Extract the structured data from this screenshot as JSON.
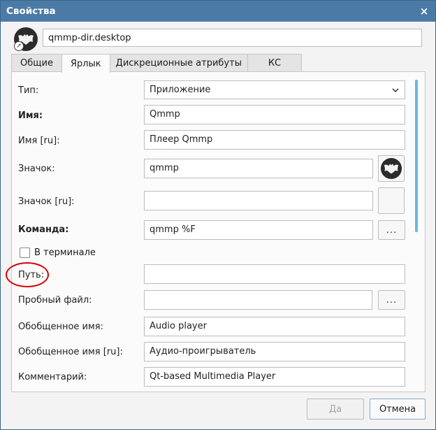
{
  "window": {
    "title": "Свойства",
    "close_glyph": "×",
    "icon_name": "qmmp-app-icon",
    "filename": "qmmp-dir.desktop"
  },
  "tabs": [
    {
      "label": "Общие",
      "active": false
    },
    {
      "label": "Ярлык",
      "active": true
    },
    {
      "label": "Дискреционные атрибуты",
      "active": false
    },
    {
      "label": "КС",
      "active": false
    }
  ],
  "form": {
    "type": {
      "label": "Тип:",
      "value": "Приложение"
    },
    "name": {
      "label": "Имя:",
      "value": "Qmmp"
    },
    "name_ru": {
      "label": "Имя [ru]:",
      "value": "Плеер Qmmp"
    },
    "icon": {
      "label": "Значок:",
      "value": "qmmp"
    },
    "icon_ru": {
      "label": "Значок [ru]:",
      "value": ""
    },
    "command": {
      "label": "Команда:",
      "value": "qmmp %F",
      "browse": "..."
    },
    "terminal": {
      "label": "В терминале",
      "checked": false
    },
    "path": {
      "label": "Путь:",
      "value": ""
    },
    "try_exec": {
      "label": "Пробный файл:",
      "value": "",
      "browse": "..."
    },
    "generic": {
      "label": "Обобщенное имя:",
      "value": "Audio player"
    },
    "generic_ru": {
      "label": "Обобщенное имя [ru]:",
      "value": "Аудио-проигрыватель"
    },
    "comment": {
      "label": "Комментарий:",
      "value": "Qt-based Multimedia Player"
    }
  },
  "buttons": {
    "ok": "Да",
    "cancel": "Отмена"
  },
  "colors": {
    "titlebar": "#4c7aa7",
    "annotation_red": "#d60000",
    "scrollbar": "#66b8e6"
  }
}
